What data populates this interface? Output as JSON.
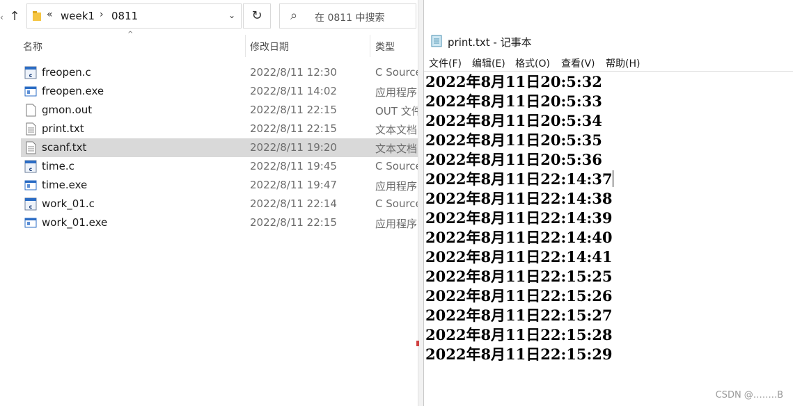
{
  "explorer": {
    "breadcrumb": {
      "sep1": "«",
      "crumb1": "week1",
      "sep2": "›",
      "crumb2": "0811"
    },
    "search_placeholder": "在 0811 中搜索",
    "columns": {
      "name": "名称",
      "date": "修改日期",
      "type": "类型"
    },
    "files": [
      {
        "name": "freopen.c",
        "date": "2022/8/11 12:30",
        "type": "C Source",
        "icon": "c-source-icon"
      },
      {
        "name": "freopen.exe",
        "date": "2022/8/11 14:02",
        "type": "应用程序",
        "icon": "exe-icon"
      },
      {
        "name": "gmon.out",
        "date": "2022/8/11 22:15",
        "type": "OUT 文件",
        "icon": "blank-file-icon"
      },
      {
        "name": "print.txt",
        "date": "2022/8/11 22:15",
        "type": "文本文档",
        "icon": "text-file-icon"
      },
      {
        "name": "scanf.txt",
        "date": "2022/8/11 19:20",
        "type": "文本文档",
        "icon": "text-file-icon"
      },
      {
        "name": "time.c",
        "date": "2022/8/11 19:45",
        "type": "C Source",
        "icon": "c-source-icon"
      },
      {
        "name": "time.exe",
        "date": "2022/8/11 19:47",
        "type": "应用程序",
        "icon": "exe-icon"
      },
      {
        "name": "work_01.c",
        "date": "2022/8/11 22:14",
        "type": "C Source",
        "icon": "c-source-icon"
      },
      {
        "name": "work_01.exe",
        "date": "2022/8/11 22:15",
        "type": "应用程序",
        "icon": "exe-icon"
      }
    ]
  },
  "notepad": {
    "title": "print.txt - 记事本",
    "menu": [
      "文件(F)",
      "编辑(E)",
      "格式(O)",
      "查看(V)",
      "帮助(H)"
    ],
    "lines": [
      "2022年8月11日20:5:32",
      "2022年8月11日20:5:33",
      "2022年8月11日20:5:34",
      "2022年8月11日20:5:35",
      "2022年8月11日20:5:36",
      "2022年8月11日22:14:37",
      "2022年8月11日22:14:38",
      "2022年8月11日22:14:39",
      "2022年8月11日22:14:40",
      "2022年8月11日22:14:41",
      "2022年8月11日22:15:25",
      "2022年8月11日22:15:26",
      "2022年8月11日22:15:27",
      "2022年8月11日22:15:28",
      "2022年8月11日22:15:29"
    ]
  },
  "watermark": "CSDN @……..B",
  "colors": {
    "selected_row": "#d9d9d9",
    "folder": "#f5c542",
    "exe_blue": "#2b6cc4"
  }
}
